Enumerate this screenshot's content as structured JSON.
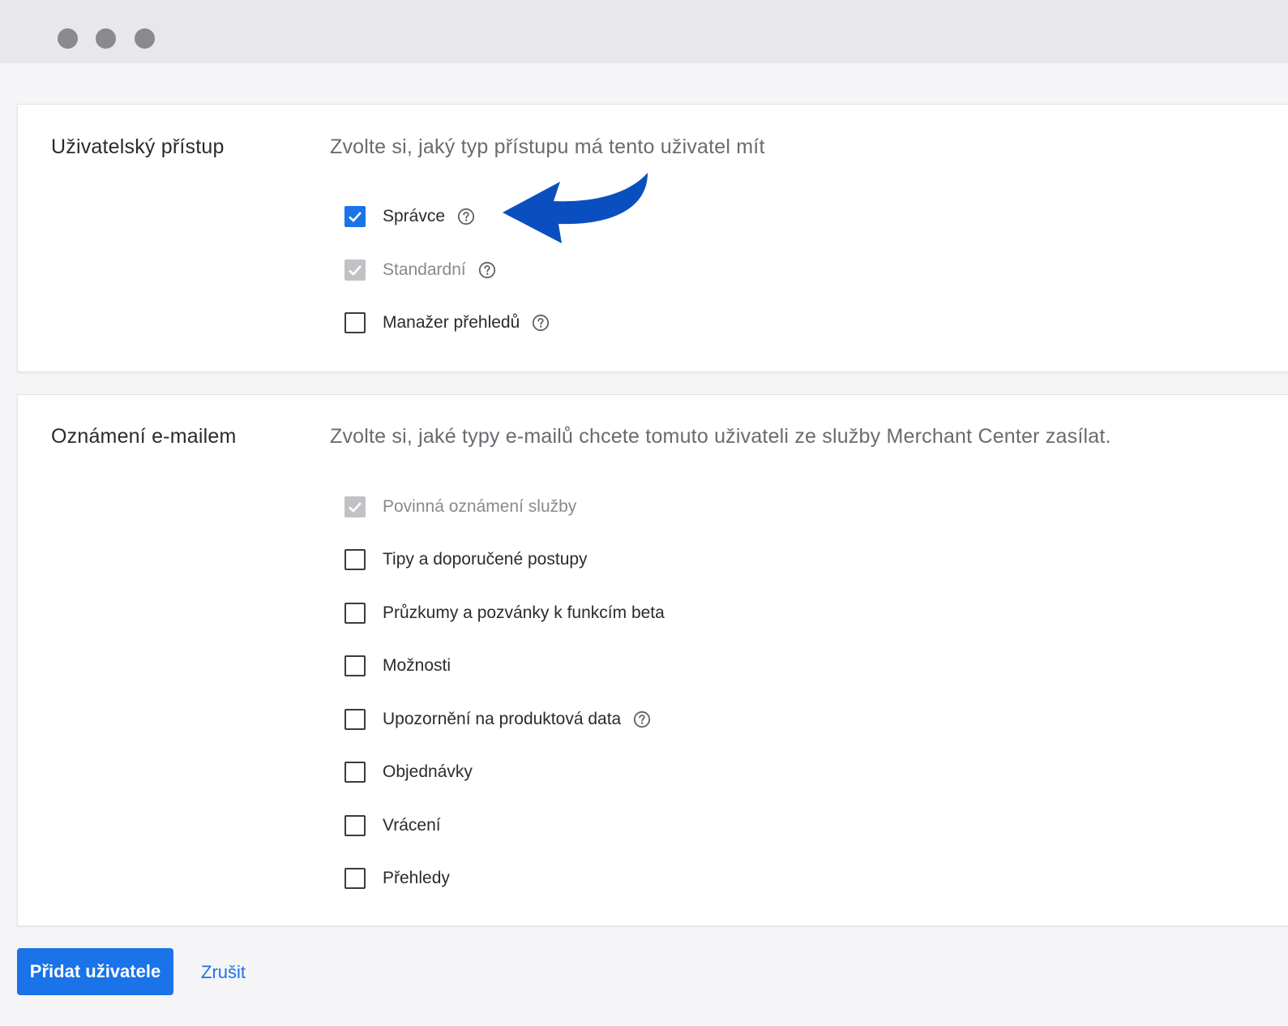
{
  "window": {
    "controls": [
      "window-dot",
      "window-dot",
      "window-dot"
    ]
  },
  "access_section": {
    "title": "Uživatelský přístup",
    "description": "Zvolte si, jaký typ přístupu má tento uživatel mít",
    "options": [
      {
        "label": "Správce",
        "checked": true,
        "disabled": false,
        "help_icon": "help-circle-icon"
      },
      {
        "label": "Standardní",
        "checked": true,
        "disabled": true,
        "help_icon": "help-circle-icon"
      },
      {
        "label": "Manažer přehledů",
        "checked": false,
        "disabled": false,
        "help_icon": "help-circle-icon"
      }
    ]
  },
  "email_section": {
    "title": "Oznámení e-mailem",
    "description": "Zvolte si, jaké typy e-mailů chcete tomuto uživateli ze služby Merchant Center zasílat.",
    "options": [
      {
        "label": "Povinná oznámení služby",
        "checked": true,
        "disabled": true
      },
      {
        "label": "Tipy a doporučené postupy",
        "checked": false,
        "disabled": false
      },
      {
        "label": "Průzkumy a pozvánky k funkcím beta",
        "checked": false,
        "disabled": false
      },
      {
        "label": "Možnosti",
        "checked": false,
        "disabled": false
      },
      {
        "label": "Upozornění na produktová data",
        "checked": false,
        "disabled": false,
        "help_icon": "help-circle-icon"
      },
      {
        "label": "Objednávky",
        "checked": false,
        "disabled": false
      },
      {
        "label": "Vrácení",
        "checked": false,
        "disabled": false
      },
      {
        "label": "Přehledy",
        "checked": false,
        "disabled": false
      }
    ]
  },
  "annotation": {
    "icon": "curved-arrow-icon",
    "color": "#0a4fbf"
  },
  "actions": {
    "primary_label": "Přidat uživatele",
    "cancel_label": "Zrušit"
  },
  "colors": {
    "accent": "#1a73e8",
    "disabled_check": "#c2c2c6",
    "text": "#2b2b2f",
    "muted_text": "#6a6a70"
  }
}
